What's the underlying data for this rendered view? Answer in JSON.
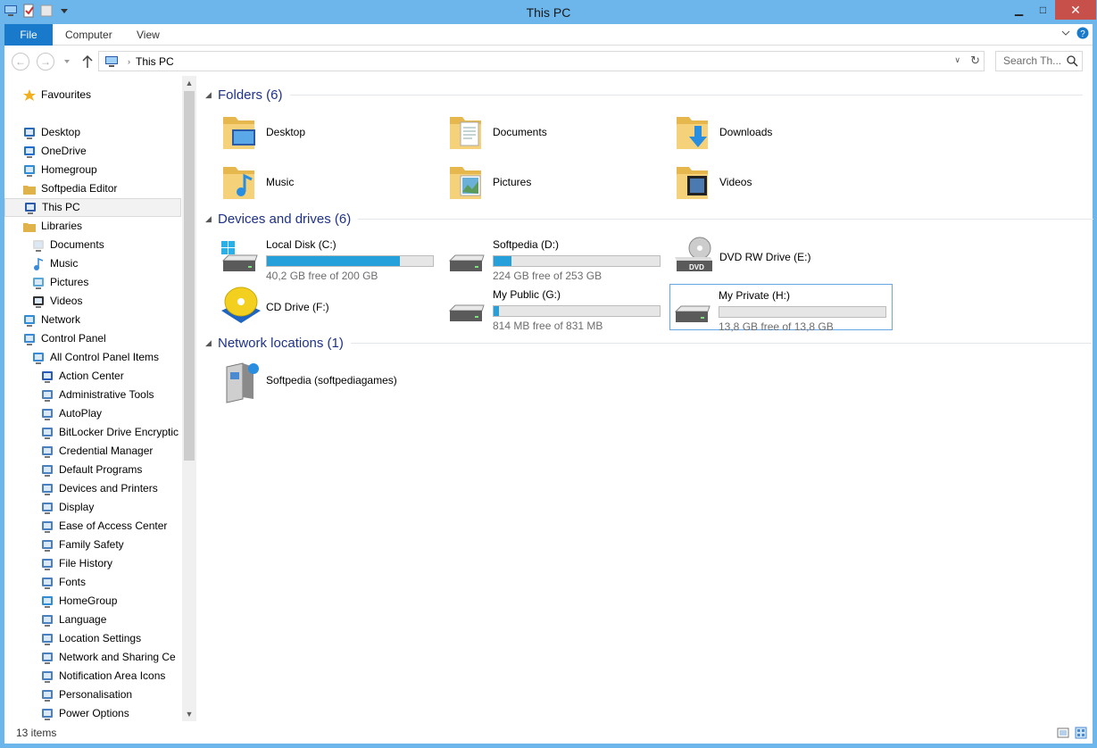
{
  "window": {
    "title": "This PC"
  },
  "ribbon": {
    "tabs": [
      "File",
      "Computer",
      "View"
    ]
  },
  "address": {
    "path": "This PC",
    "search_placeholder": "Search Th..."
  },
  "sidebar": {
    "items": [
      {
        "label": "Favourites",
        "icon": "star-icon",
        "indent": 0
      },
      {
        "label": "Desktop",
        "icon": "desktop-icon",
        "indent": 0
      },
      {
        "label": "OneDrive",
        "icon": "onedrive-icon",
        "indent": 1
      },
      {
        "label": "Homegroup",
        "icon": "homegroup-icon",
        "indent": 1
      },
      {
        "label": "Softpedia Editor",
        "icon": "user-folder-icon",
        "indent": 1
      },
      {
        "label": "This PC",
        "icon": "computer-icon",
        "indent": 1,
        "selected": true
      },
      {
        "label": "Libraries",
        "icon": "libraries-icon",
        "indent": 1
      },
      {
        "label": "Documents",
        "icon": "documents-icon",
        "indent": 2
      },
      {
        "label": "Music",
        "icon": "music-icon",
        "indent": 2
      },
      {
        "label": "Pictures",
        "icon": "pictures-icon",
        "indent": 2
      },
      {
        "label": "Videos",
        "icon": "videos-icon",
        "indent": 2
      },
      {
        "label": "Network",
        "icon": "network-icon",
        "indent": 1
      },
      {
        "label": "Control Panel",
        "icon": "control-panel-icon",
        "indent": 1
      },
      {
        "label": "All Control Panel Items",
        "icon": "control-panel-items-icon",
        "indent": 2
      },
      {
        "label": "Action Center",
        "icon": "flag-icon",
        "indent": 3
      },
      {
        "label": "Administrative Tools",
        "icon": "admin-tools-icon",
        "indent": 3
      },
      {
        "label": "AutoPlay",
        "icon": "autoplay-icon",
        "indent": 3
      },
      {
        "label": "BitLocker Drive Encryptic",
        "icon": "bitlocker-icon",
        "indent": 3
      },
      {
        "label": "Credential Manager",
        "icon": "credential-icon",
        "indent": 3
      },
      {
        "label": "Default Programs",
        "icon": "default-programs-icon",
        "indent": 3
      },
      {
        "label": "Devices and Printers",
        "icon": "printer-icon",
        "indent": 3
      },
      {
        "label": "Display",
        "icon": "display-icon",
        "indent": 3
      },
      {
        "label": "Ease of Access Center",
        "icon": "accessibility-icon",
        "indent": 3
      },
      {
        "label": "Family Safety",
        "icon": "family-icon",
        "indent": 3
      },
      {
        "label": "File History",
        "icon": "file-history-icon",
        "indent": 3
      },
      {
        "label": "Fonts",
        "icon": "fonts-icon",
        "indent": 3
      },
      {
        "label": "HomeGroup",
        "icon": "homegroup-icon",
        "indent": 3
      },
      {
        "label": "Language",
        "icon": "language-icon",
        "indent": 3
      },
      {
        "label": "Location Settings",
        "icon": "location-icon",
        "indent": 3
      },
      {
        "label": "Network and Sharing Ce",
        "icon": "network-sharing-icon",
        "indent": 3
      },
      {
        "label": "Notification Area Icons",
        "icon": "notification-icon",
        "indent": 3
      },
      {
        "label": "Personalisation",
        "icon": "personalisation-icon",
        "indent": 3
      },
      {
        "label": "Power Options",
        "icon": "power-icon",
        "indent": 3
      }
    ]
  },
  "groups": {
    "folders": {
      "title": "Folders (6)"
    },
    "devices": {
      "title": "Devices and drives (6)"
    },
    "network": {
      "title": "Network locations (1)"
    }
  },
  "folders": [
    "Desktop",
    "Documents",
    "Downloads",
    "Music",
    "Pictures",
    "Videos"
  ],
  "drives": [
    {
      "label": "Local Disk (C:)",
      "free": "40,2 GB free of 200 GB",
      "used_fraction": 0.8,
      "icon": "windows-drive-icon"
    },
    {
      "label": "Softpedia (D:)",
      "free": "224 GB free of 253 GB",
      "used_fraction": 0.11,
      "icon": "hard-drive-icon"
    },
    {
      "label": "DVD RW Drive (E:)",
      "icon": "dvd-drive-icon"
    },
    {
      "label": "CD Drive (F:)",
      "icon": "cd-drive-icon"
    },
    {
      "label": "My Public (G:)",
      "free": "814 MB free of 831 MB",
      "used_fraction": 0.02,
      "icon": "hard-drive-icon"
    },
    {
      "label": "My Private (H:)",
      "free": "13,8 GB free of 13,8 GB",
      "used_fraction": 0.0,
      "icon": "hard-drive-icon",
      "selected": true
    }
  ],
  "network_locations": [
    {
      "label": "Softpedia (softpediagames)",
      "icon": "network-share-icon"
    }
  ],
  "status": {
    "items": "13 items"
  },
  "colors": {
    "titlebar": "#6cb6ec",
    "accent": "#1979ca",
    "bar_fill": "#26a0da",
    "group_header": "#1e3287"
  }
}
